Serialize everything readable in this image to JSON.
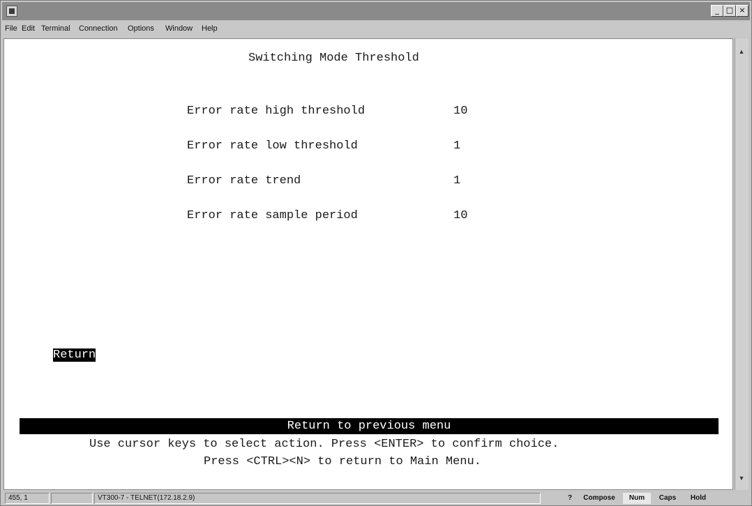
{
  "window": {
    "controls": {
      "minimize": "_",
      "maximize": "□",
      "close": "×"
    }
  },
  "menubar": {
    "items": [
      "File",
      "Edit",
      "Terminal",
      "Connection",
      "Options",
      "Window",
      "Help"
    ]
  },
  "screen": {
    "title": "Switching Mode Threshold",
    "fields": [
      {
        "label": "Error rate high threshold",
        "value": "10"
      },
      {
        "label": "Error rate low threshold",
        "value": "1"
      },
      {
        "label": "Error rate trend",
        "value": "1"
      },
      {
        "label": "Error rate sample period",
        "value": "10"
      }
    ],
    "return_action": "Return",
    "help_bar": "Return to previous menu",
    "instructions_line1": "Use cursor keys to select action. Press <ENTER> to confirm choice.",
    "instructions_line2": "Press <CTRL><N> to return to Main Menu."
  },
  "statusbar": {
    "position": "455, 1",
    "connection": "VT300-7 - TELNET(172.18.2.9)",
    "help": "?",
    "compose": "Compose",
    "num": "Num",
    "caps": "Caps",
    "hold": "Hold"
  }
}
